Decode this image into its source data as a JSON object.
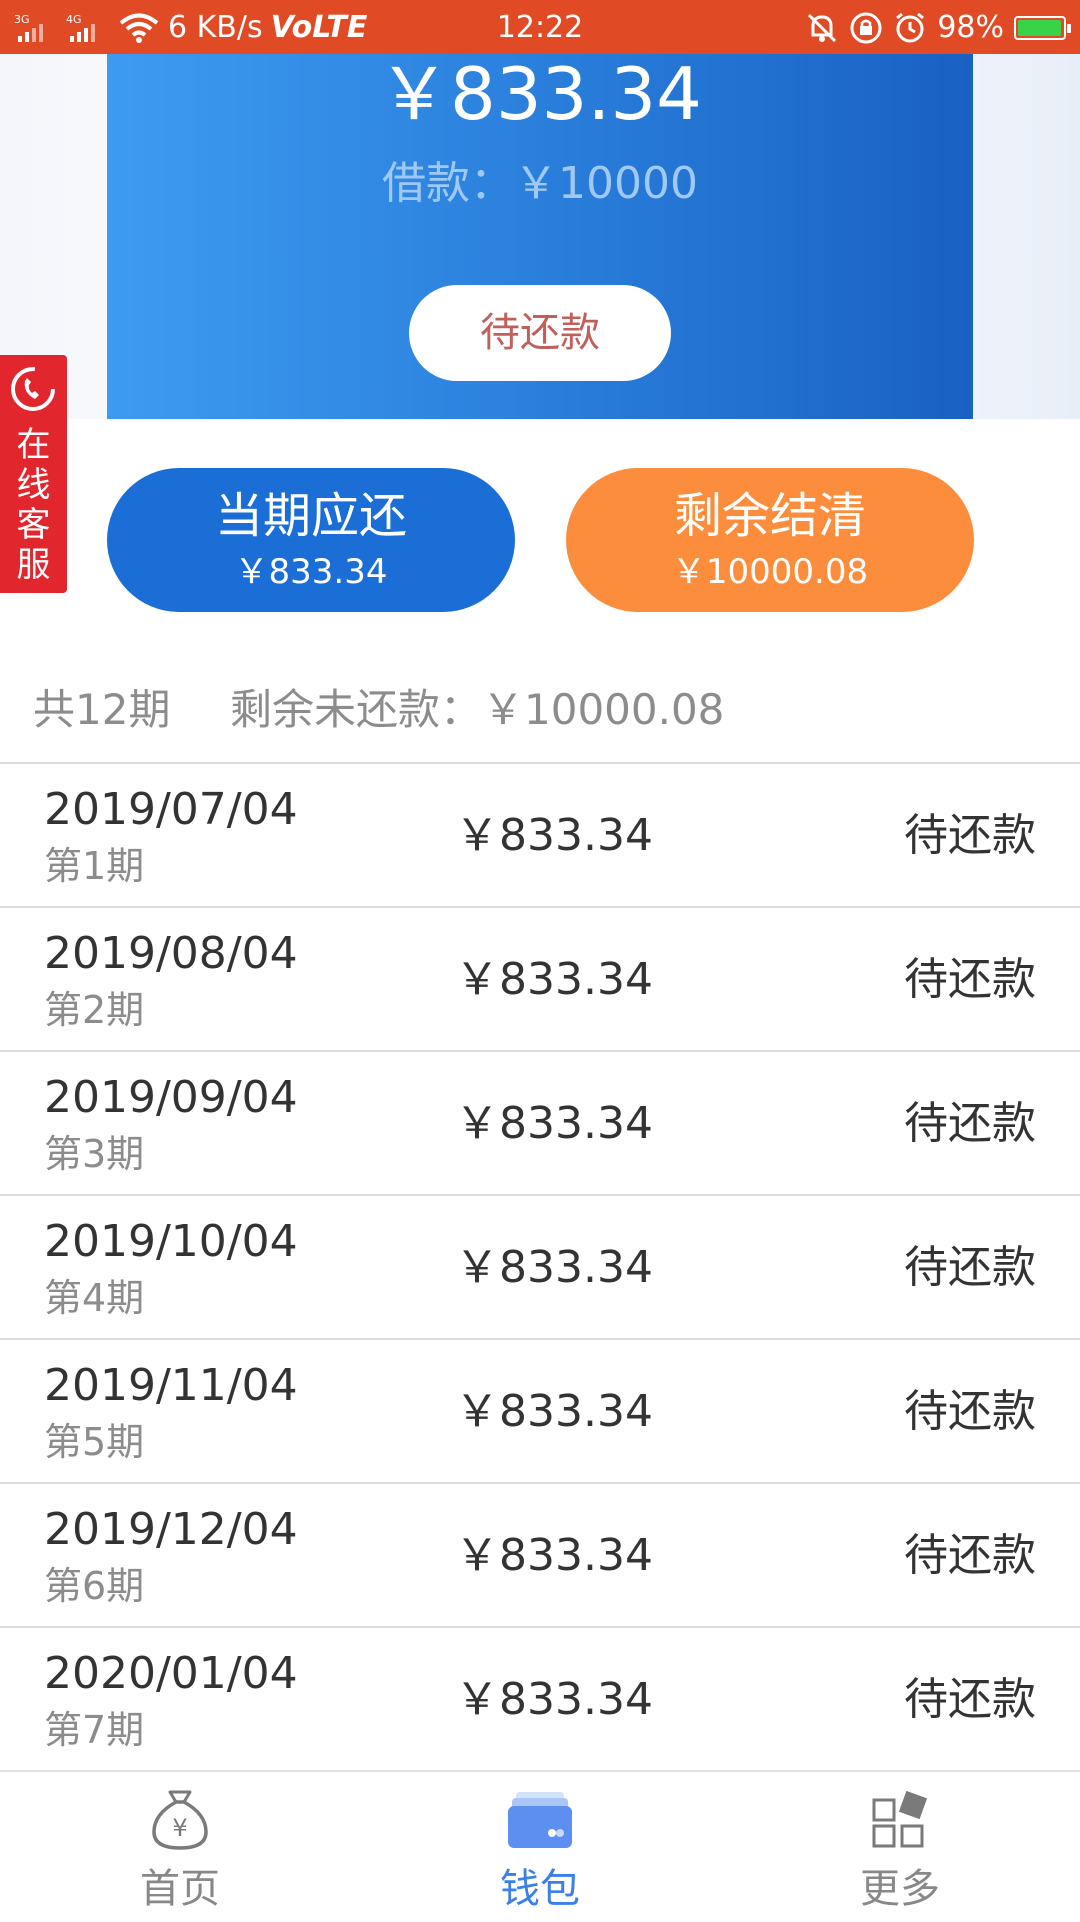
{
  "status_bar": {
    "network_left": "3G",
    "network_right": "4G",
    "speed": "6 KB/s",
    "volte": "VoLTE",
    "time": "12:22",
    "battery": "98%"
  },
  "hero": {
    "amount": "￥833.34",
    "loan": "借款：￥10000",
    "status_button": "待还款"
  },
  "service_tab": {
    "label": "在线客服"
  },
  "actions": {
    "current": {
      "title": "当期应还",
      "amount": "￥833.34"
    },
    "settle": {
      "title": "剩余结清",
      "amount": "￥10000.08"
    }
  },
  "summary": {
    "total_periods": "共12期",
    "remaining": "剩余未还款：￥10000.08"
  },
  "installments": [
    {
      "date": "2019/07/04",
      "period": "第1期",
      "amount": "￥833.34",
      "status": "待还款"
    },
    {
      "date": "2019/08/04",
      "period": "第2期",
      "amount": "￥833.34",
      "status": "待还款"
    },
    {
      "date": "2019/09/04",
      "period": "第3期",
      "amount": "￥833.34",
      "status": "待还款"
    },
    {
      "date": "2019/10/04",
      "period": "第4期",
      "amount": "￥833.34",
      "status": "待还款"
    },
    {
      "date": "2019/11/04",
      "period": "第5期",
      "amount": "￥833.34",
      "status": "待还款"
    },
    {
      "date": "2019/12/04",
      "period": "第6期",
      "amount": "￥833.34",
      "status": "待还款"
    },
    {
      "date": "2020/01/04",
      "period": "第7期",
      "amount": "￥833.34",
      "status": "待还款"
    }
  ],
  "bottom_nav": {
    "items": [
      {
        "label": "首页",
        "icon": "money-bag-icon",
        "active": false
      },
      {
        "label": "钱包",
        "icon": "wallet-icon",
        "active": true
      },
      {
        "label": "更多",
        "icon": "grid-more-icon",
        "active": false
      }
    ]
  },
  "colors": {
    "status_bar": "#e04b26",
    "hero_start": "#3d9bf0",
    "hero_end": "#1961c3",
    "current_button": "#1a6ed6",
    "settle_button": "#fb8d3c",
    "service_tab": "#e2262e",
    "nav_active": "#3b7fe8"
  }
}
